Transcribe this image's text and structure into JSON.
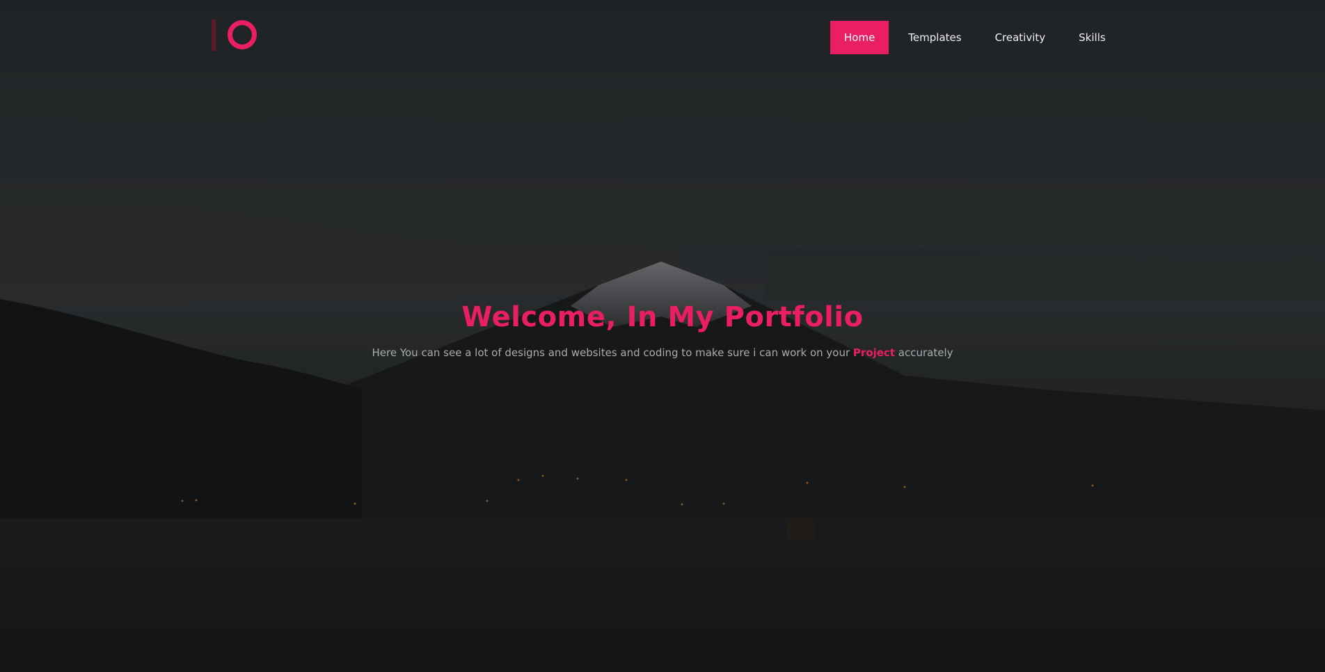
{
  "header": {
    "logo_name": "io-logo"
  },
  "nav": {
    "items": [
      {
        "label": "Home",
        "active": true
      },
      {
        "label": "Templates",
        "active": false
      },
      {
        "label": "Creativity",
        "active": false
      },
      {
        "label": "Skills",
        "active": false
      }
    ]
  },
  "hero": {
    "title": "Welcome, In My Portfolio",
    "subtitle_before": "Here You can see a lot of designs and websites and coding to make sure i can work on your",
    "subtitle_accent": "Project",
    "subtitle_after": "accurately"
  },
  "colors": {
    "accent": "#e91e63",
    "header_bg": "#212426",
    "text_muted": "#a9acae"
  }
}
